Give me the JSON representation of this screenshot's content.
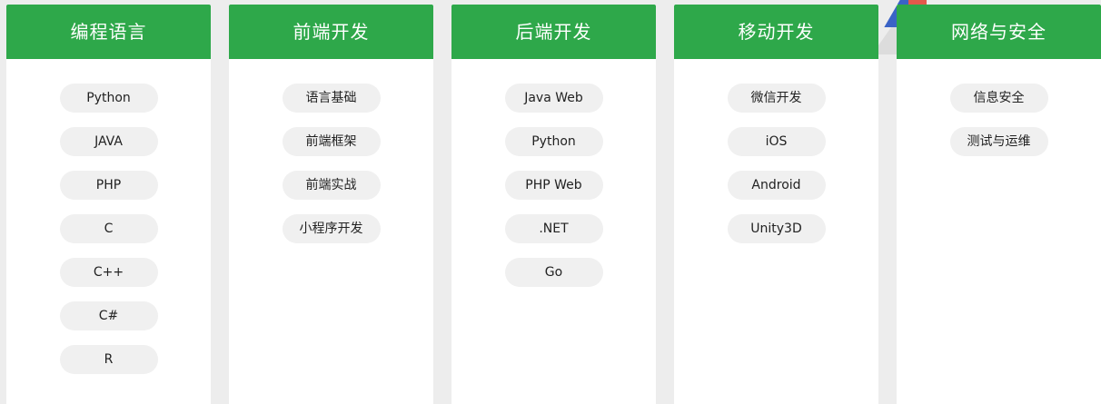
{
  "categories": [
    {
      "title": "编程语言",
      "items": [
        "Python",
        "JAVA",
        "PHP",
        "C",
        "C++",
        "C#",
        "R"
      ]
    },
    {
      "title": "前端开发",
      "items": [
        "语言基础",
        "前端框架",
        "前端实战",
        "小程序开发"
      ]
    },
    {
      "title": "后端开发",
      "items": [
        "Java Web",
        "Python",
        "PHP Web",
        ".NET",
        "Go"
      ]
    },
    {
      "title": "移动开发",
      "items": [
        "微信开发",
        "iOS",
        "Android",
        "Unity3D"
      ]
    },
    {
      "title": "网络与安全",
      "items": [
        "信息安全",
        "测试与运维"
      ]
    }
  ],
  "colors": {
    "header": "#2ea84a",
    "tag_bg": "#f0f0f0",
    "page_bg": "#ededed"
  }
}
